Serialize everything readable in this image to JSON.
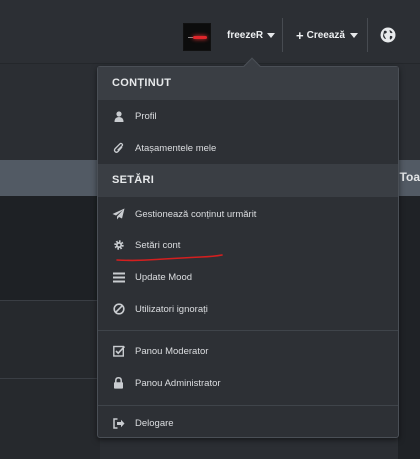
{
  "topnav": {
    "username": "freezeR",
    "create_label": "Creează",
    "background_text": "Toat"
  },
  "dropdown": {
    "section_content": "CONȚINUT",
    "section_settings": "SETĂRI",
    "items_content": [
      {
        "label": "Profil",
        "icon": "user-icon"
      },
      {
        "label": "Atașamentele mele",
        "icon": "paperclip-icon"
      }
    ],
    "items_settings": [
      {
        "label": "Gestionează conținut urmărit",
        "icon": "paper-plane-icon"
      },
      {
        "label": "Setări cont",
        "icon": "gear-icon"
      },
      {
        "label": "Update Mood",
        "icon": "bars-icon"
      },
      {
        "label": "Utilizatori ignorați",
        "icon": "ban-icon"
      }
    ],
    "items_admin": [
      {
        "label": "Panou Moderator",
        "icon": "checkbox-icon"
      },
      {
        "label": "Panou Administrator",
        "icon": "lock-icon"
      }
    ],
    "logout_label": "Delogare"
  },
  "colors": {
    "annotation_underline": "#d41f1f",
    "avatar_streak": "#e0262b"
  }
}
